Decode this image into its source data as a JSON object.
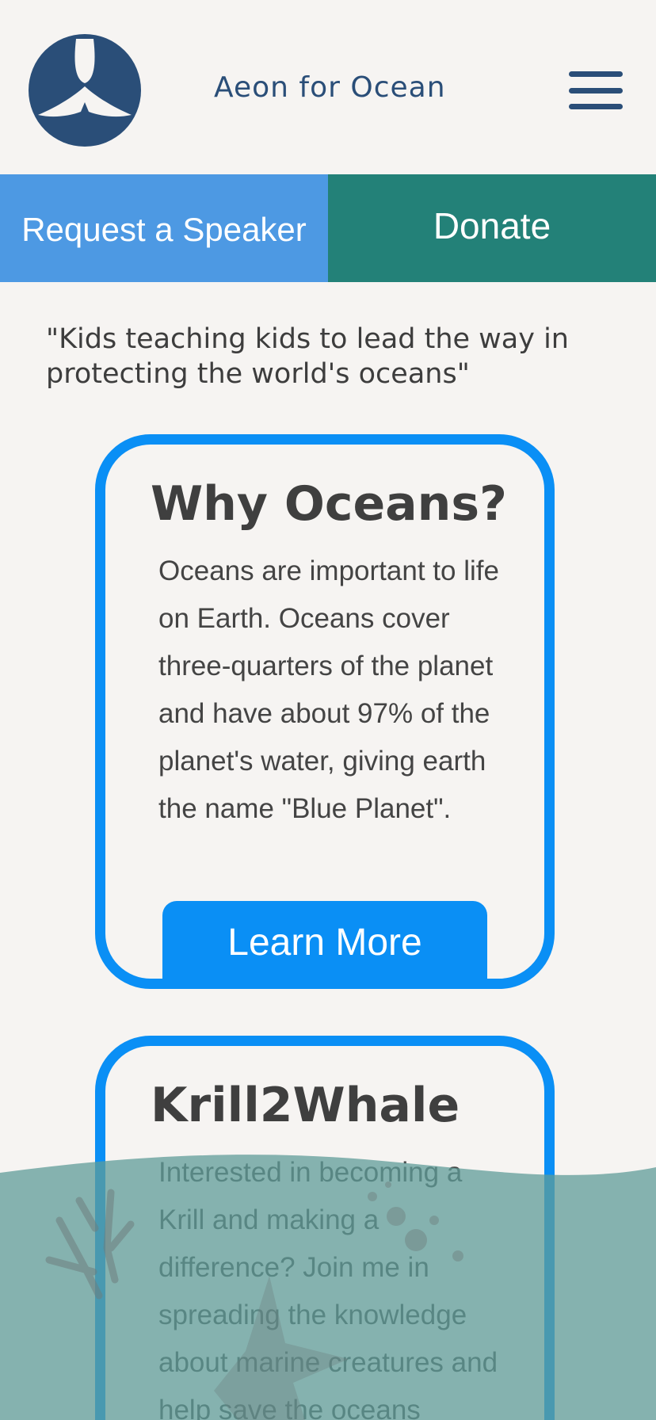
{
  "header": {
    "brand": "Aeon for Ocean",
    "logo_icon": "whale-tail-icon",
    "menu_icon": "hamburger-menu-icon"
  },
  "cta": {
    "speaker_label": "Request a Speaker",
    "donate_label": "Donate"
  },
  "quote": "\"Kids teaching kids to lead the way in protecting the world's oceans\"",
  "cards": [
    {
      "title": "Why Oceans?",
      "text": "Oceans are important to life on Earth. Oceans cover three-quarters of the planet and have about 97% of the planet's water, giving earth the name \"Blue Planet\".",
      "button": "Learn More"
    },
    {
      "title": "Krill2Whale",
      "text": "Interested in becoming a Krill and making a difference? Join me in spreading the knowledge about marine creatures and help save the oceans"
    }
  ],
  "colors": {
    "brand": "#2a4e78",
    "speaker_bg": "#4d99e3",
    "donate_bg": "#238178",
    "card_border": "#0a8ff5",
    "ocean": "#5f9c98"
  }
}
